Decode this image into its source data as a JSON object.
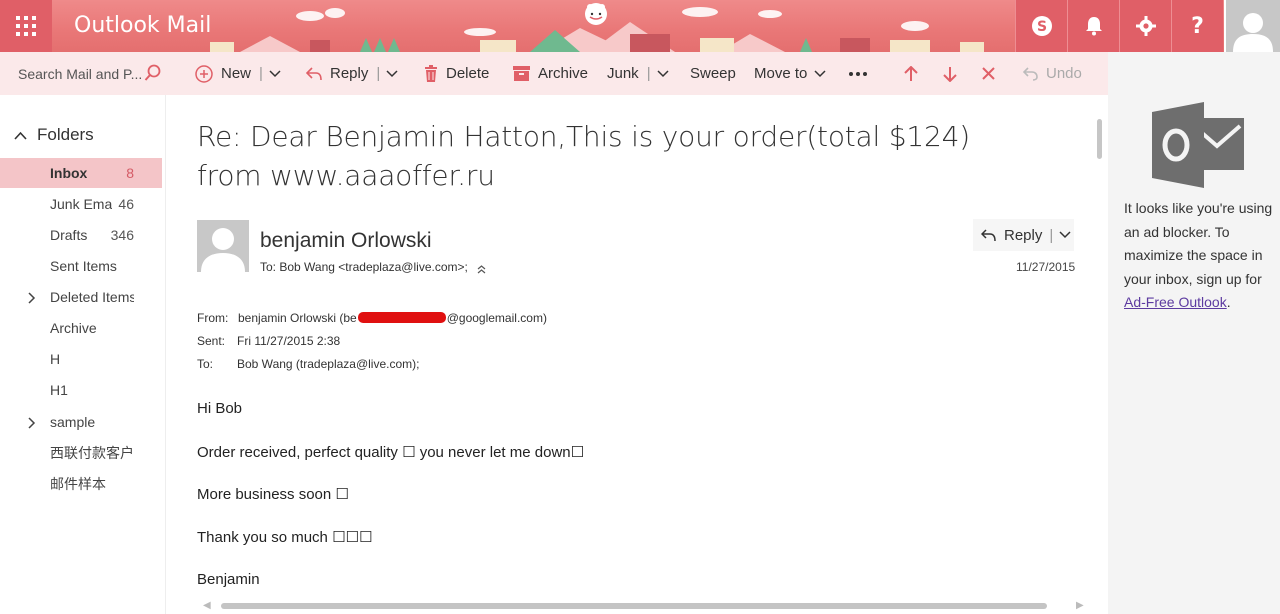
{
  "header": {
    "app_title": "Outlook Mail",
    "accent_color": "#e97777",
    "icons": [
      "app-launcher-icon",
      "skype-icon",
      "bell-icon",
      "gear-icon",
      "help-icon",
      "user-avatar-icon"
    ]
  },
  "search": {
    "placeholder": "Search Mail and P..."
  },
  "commands": {
    "new": "New",
    "reply": "Reply",
    "delete": "Delete",
    "archive": "Archive",
    "junk": "Junk",
    "sweep": "Sweep",
    "move_to": "Move to",
    "undo": "Undo"
  },
  "folders": {
    "header": "Folders",
    "items": [
      {
        "name": "Inbox",
        "count": "8",
        "selected": true
      },
      {
        "name": "Junk Ema",
        "count": "46"
      },
      {
        "name": "Drafts",
        "count": "346"
      },
      {
        "name": "Sent Items",
        "count": ""
      },
      {
        "name": "Deleted Items",
        "count": "",
        "expandable": true
      },
      {
        "name": "Archive",
        "count": ""
      },
      {
        "name": "H",
        "count": ""
      },
      {
        "name": "H1",
        "count": ""
      },
      {
        "name": "sample",
        "count": "",
        "expandable": true
      },
      {
        "name": "西联付款客户",
        "count": ""
      },
      {
        "name": "邮件样本",
        "count": ""
      }
    ]
  },
  "message": {
    "subject": "Re: Dear Benjamin Hatton,This is your order(total $124) from www.aaaoffer.ru",
    "sender": "benjamin Orlowski",
    "to_line": "To: Bob Wang <tradeplaza@live.com>;",
    "reply_label": "Reply",
    "date": "11/27/2015",
    "headers": {
      "from_label": "From:",
      "from_name_prefix": "benjamin Orlowski (be",
      "from_suffix": "@googlemail.com)",
      "sent_label": "Sent:",
      "sent_value": "Fri 11/27/2015 2:38",
      "to_label": "To:",
      "to_value": "Bob Wang (tradeplaza@live.com);"
    },
    "body": [
      "Hi Bob",
      "Order received, perfect quality ☐ you never let me down☐",
      "More business soon ☐",
      "Thank you so much ☐☐☐",
      "Benjamin"
    ]
  },
  "ad": {
    "text": "It looks like you're using an ad blocker. To maximize the space in your inbox, sign up for",
    "link": "Ad-Free Outlook",
    "after_link": "."
  }
}
